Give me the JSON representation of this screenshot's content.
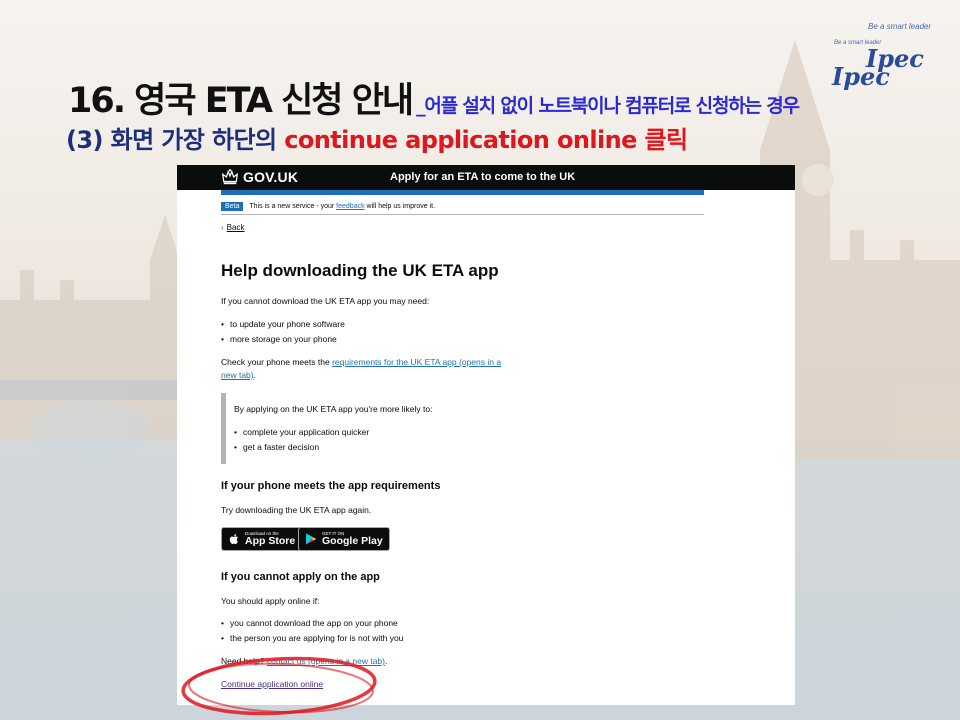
{
  "slide": {
    "title": "16. 영국 ETA 신청 안내",
    "title_sub": "_어플 설치 없이 노트북이나 컴퓨터로 신청하는 경우",
    "subtitle_num": "(3) 화면 가장 하단의",
    "subtitle_red": "continue application online 클릭"
  },
  "logo": {
    "tagline_top": "Be a smart leader",
    "tagline_small": "Be a smart leader",
    "word1": "Ipec",
    "word2": "Ipec"
  },
  "header": {
    "logo_text": "GOV.UK",
    "service_name": "Apply for an ETA to come to the UK"
  },
  "phase": {
    "tag": "Beta",
    "text_before": "This is a new service - your",
    "link": "feedback",
    "text_after": "will help us improve it."
  },
  "back_label": "Back",
  "page": {
    "heading": "Help downloading the UK ETA app",
    "intro": "If you cannot download the UK ETA app you may need:",
    "needs": [
      "to update your phone software",
      "more storage on your phone"
    ],
    "check_before": "Check your phone meets the",
    "check_link_1": "requirements for the UK ETA app (opens in a",
    "check_link_2": "new tab)",
    "check_after": ".",
    "inset_text": "By applying on the UK ETA app you're more likely to:",
    "inset_items": [
      "complete your application quicker",
      "get a faster decision"
    ],
    "h2_meets": "If your phone meets the app requirements",
    "try_again": "Try downloading the UK ETA app again.",
    "h2_cannot": "If you cannot apply on the app",
    "apply_online_if": "You should apply online if:",
    "online_reasons": [
      "you cannot download the app on your phone",
      "the person you are applying for is not with you"
    ],
    "help_before": "Need help?",
    "help_link": "contact us (opens in a new tab)",
    "help_after": ".",
    "continue_link": "Continue application online"
  },
  "stores": {
    "apple_small": "Download on the",
    "apple_big": "App Store",
    "google_small": "GET IT ON",
    "google_big": "Google Play"
  },
  "colors": {
    "gov_black": "#0b0c0c",
    "gov_blue": "#1d70b8",
    "annotation_red": "#e0161d",
    "title_blue": "#2a2ad0"
  }
}
